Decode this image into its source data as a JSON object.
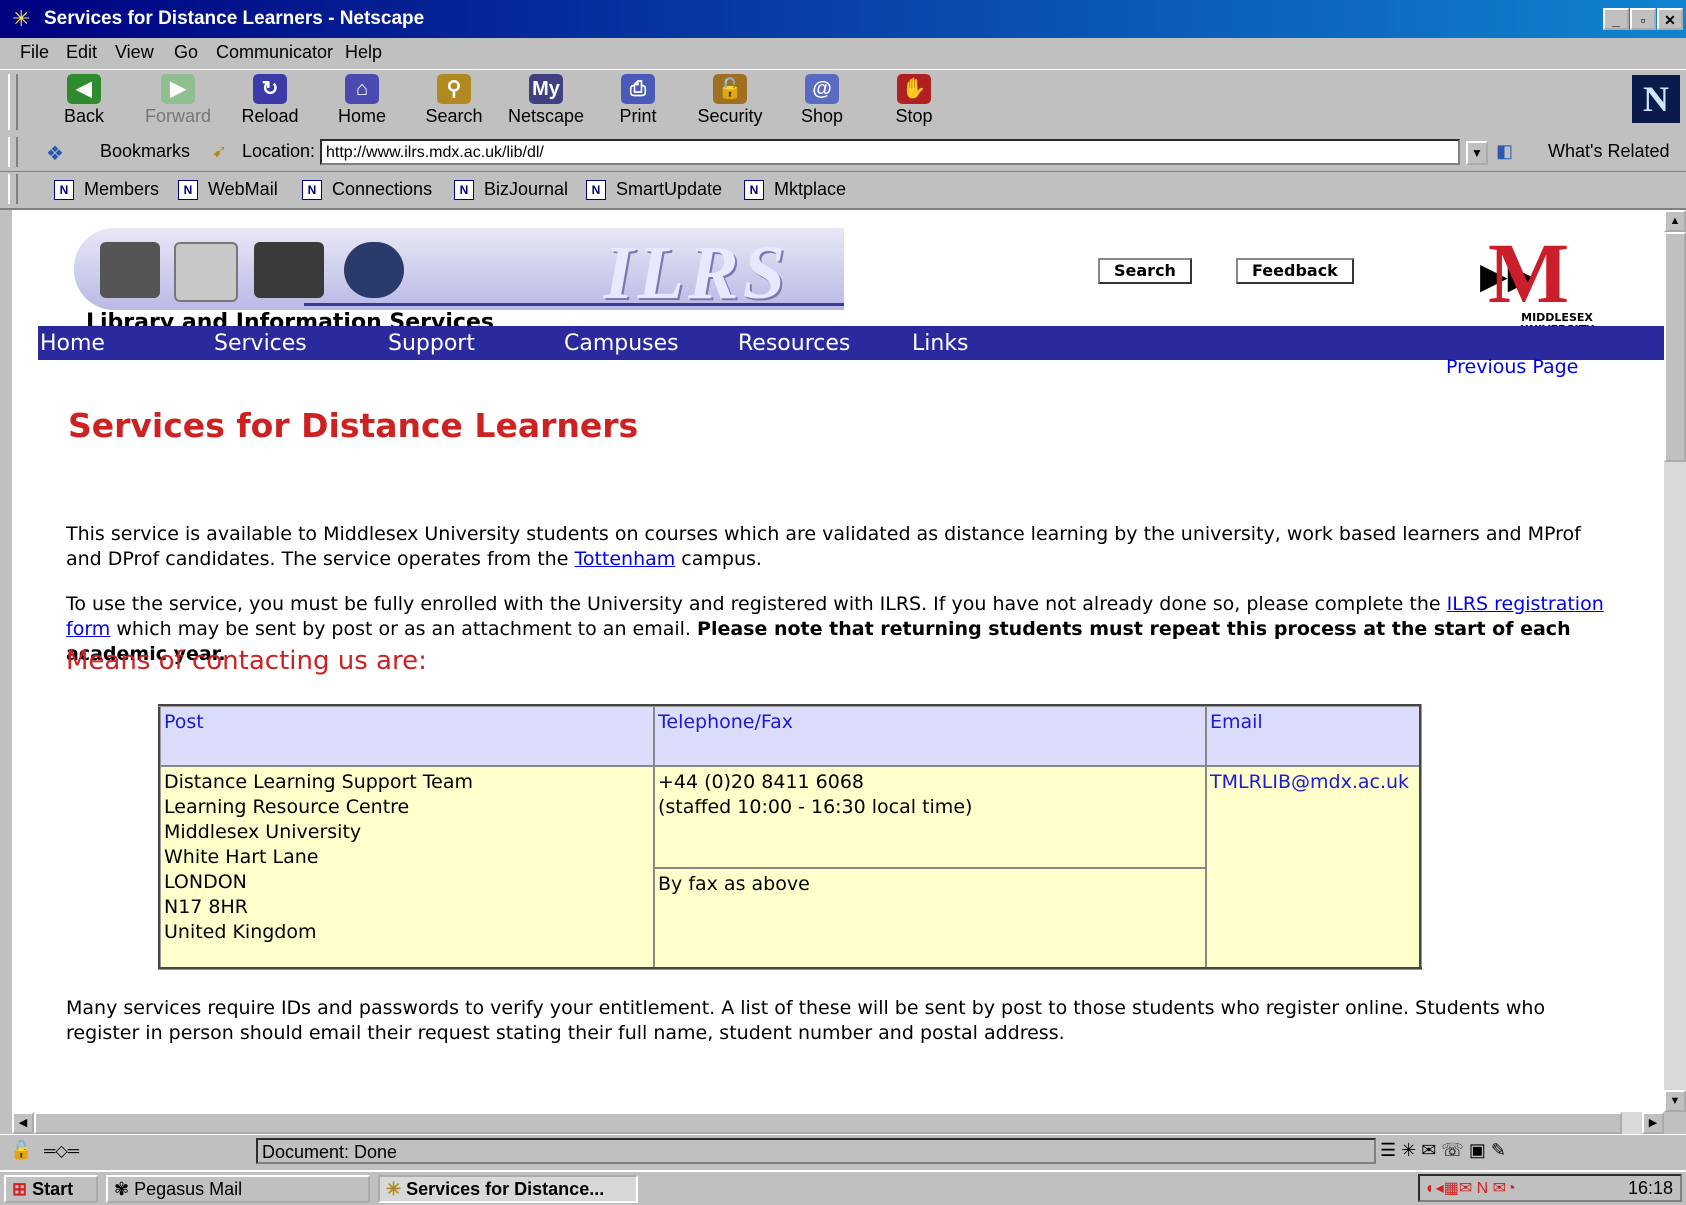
{
  "window": {
    "title": "Services for Distance Learners - Netscape",
    "min": "_",
    "max": "▫",
    "close": "✕"
  },
  "menu": [
    "File",
    "Edit",
    "View",
    "Go",
    "Communicator",
    "Help"
  ],
  "toolbar": [
    {
      "label": "Back",
      "icon": "back-arrow-icon",
      "color": "#2e8b2e"
    },
    {
      "label": "Forward",
      "icon": "forward-arrow-icon",
      "color": "#8fbf8f"
    },
    {
      "label": "Reload",
      "icon": "reload-icon",
      "color": "#3a3aa8"
    },
    {
      "label": "Home",
      "icon": "home-icon",
      "color": "#4a4ab0"
    },
    {
      "label": "Search",
      "icon": "search-icon",
      "color": "#b08a20"
    },
    {
      "label": "Netscape",
      "icon": "my-netscape-icon",
      "color": "#404080"
    },
    {
      "label": "Print",
      "icon": "print-icon",
      "color": "#4a5ab8"
    },
    {
      "label": "Security",
      "icon": "lock-icon",
      "color": "#a07020"
    },
    {
      "label": "Shop",
      "icon": "shop-icon",
      "color": "#5a6ac0"
    },
    {
      "label": "Stop",
      "icon": "stop-icon",
      "color": "#b02020"
    }
  ],
  "location": {
    "bookmarks_label": "Bookmarks",
    "location_label": "Location:",
    "url": "http://www.ilrs.mdx.ac.uk/lib/dl/",
    "whats_related": "What's Related"
  },
  "personal_toolbar": [
    "Members",
    "WebMail",
    "Connections",
    "BizJournal",
    "SmartUpdate",
    "Mktplace"
  ],
  "page": {
    "logo_text": "ILRS",
    "subtitle": "Library and Information Services",
    "search_button": "Search",
    "feedback_button": "Feedback",
    "university_logo": "MIDDLESEX UNIVERSITY",
    "nav": [
      "Home",
      "Services",
      "Support",
      "Campuses",
      "Resources",
      "Links"
    ],
    "previous_page": "Previous Page",
    "heading": "Services for Distance Learners",
    "para1_a": "This service is available to Middlesex University students on courses which are validated as distance learning by the university, work based learners and MProf and DProf candidates. The service operates from the ",
    "para1_link": "Tottenham",
    "para1_b": " campus.",
    "para2_a": "To use the service, you must be fully enrolled with the University and registered with ILRS. If you have not already done so, please complete the ",
    "para2_link": "ILRS registration form",
    "para2_b": " which may be sent by post or as an attachment to an email. ",
    "para2_bold": "Please note that returning students must repeat this process at the start of each academic year.",
    "subheading": "Means of contacting us are:",
    "table": {
      "headers": [
        "Post",
        "Telephone/Fax",
        "Email"
      ],
      "post": [
        "Distance Learning Support Team",
        "Learning Resource Centre",
        "Middlesex University",
        "White Hart Lane",
        "LONDON",
        "N17 8HR",
        "United Kingdom"
      ],
      "phone": [
        "+44 (0)20 8411 6068",
        "(staffed 10:00 - 16:30 local time)"
      ],
      "fax": "By fax as above",
      "email": "TMLRLIB@mdx.ac.uk"
    },
    "para3": "Many services require IDs and passwords to verify your entitlement. A list of these will be sent by post to those students who register online. Students who register in person should email their request stating their full name, student number and postal address."
  },
  "status": {
    "text": "Document: Done"
  },
  "taskbar": {
    "start": "Start",
    "tasks": [
      "Pegasus Mail",
      "Services for Distance..."
    ],
    "clock": "16:18"
  }
}
